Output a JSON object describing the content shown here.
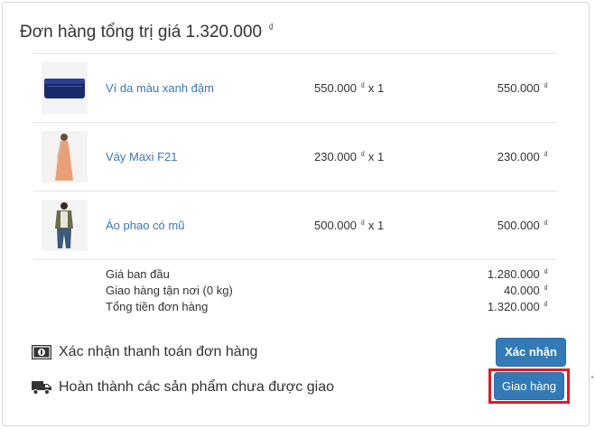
{
  "order": {
    "title": "Đơn hàng tổng trị giá 1.320.000",
    "currency_symbol": "₫"
  },
  "items": [
    {
      "name": "Ví da màu xanh đậm",
      "unit_price": "550.000",
      "qty_text": "x 1",
      "total": "550.000",
      "image_icon": "blue-wallet-image"
    },
    {
      "name": "Váy Maxi F21",
      "unit_price": "230.000",
      "qty_text": "x 1",
      "total": "230.000",
      "image_icon": "maxi-dress-image"
    },
    {
      "name": "Áo phao có mũ",
      "unit_price": "500.000",
      "qty_text": "x 1",
      "total": "500.000",
      "image_icon": "hooded-vest-image"
    }
  ],
  "summary": [
    {
      "label": "Giá ban đầu",
      "value": "1.280.000"
    },
    {
      "label": "Giao hàng tận nơi (0 kg)",
      "value": "40.000"
    },
    {
      "label": "Tổng tiền đơn hàng",
      "value": "1.320.000"
    }
  ],
  "actions": {
    "payment": {
      "text": "Xác nhận thanh toán đơn hàng",
      "icon": "money-icon",
      "button": "Xác nhận"
    },
    "shipping": {
      "text": "Hoàn thành các sản phẩm chưa được giao",
      "icon": "truck-icon",
      "button": "Giao hàng"
    }
  },
  "colors": {
    "link": "#3b76b5",
    "button": "#337ab7",
    "highlight": "#e01b24"
  }
}
